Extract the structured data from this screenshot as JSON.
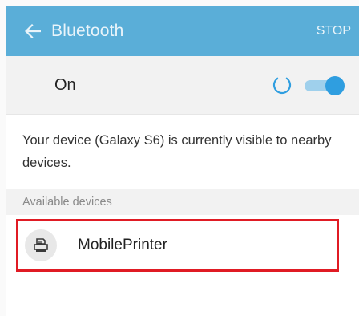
{
  "appbar": {
    "title": "Bluetooth",
    "stop_label": "STOP",
    "back_icon": "arrow-left-icon",
    "background": "#5aaed8"
  },
  "toggle": {
    "label": "On",
    "state": "on",
    "scanning": true,
    "accent": "#2f9ee0"
  },
  "visibility": {
    "text": "Your device (Galaxy S6) is currently visible to nearby devices."
  },
  "available": {
    "header": "Available devices",
    "devices": [
      {
        "name": "MobilePrinter",
        "icon": "printer-icon",
        "highlight_color": "#e01b24"
      }
    ]
  }
}
